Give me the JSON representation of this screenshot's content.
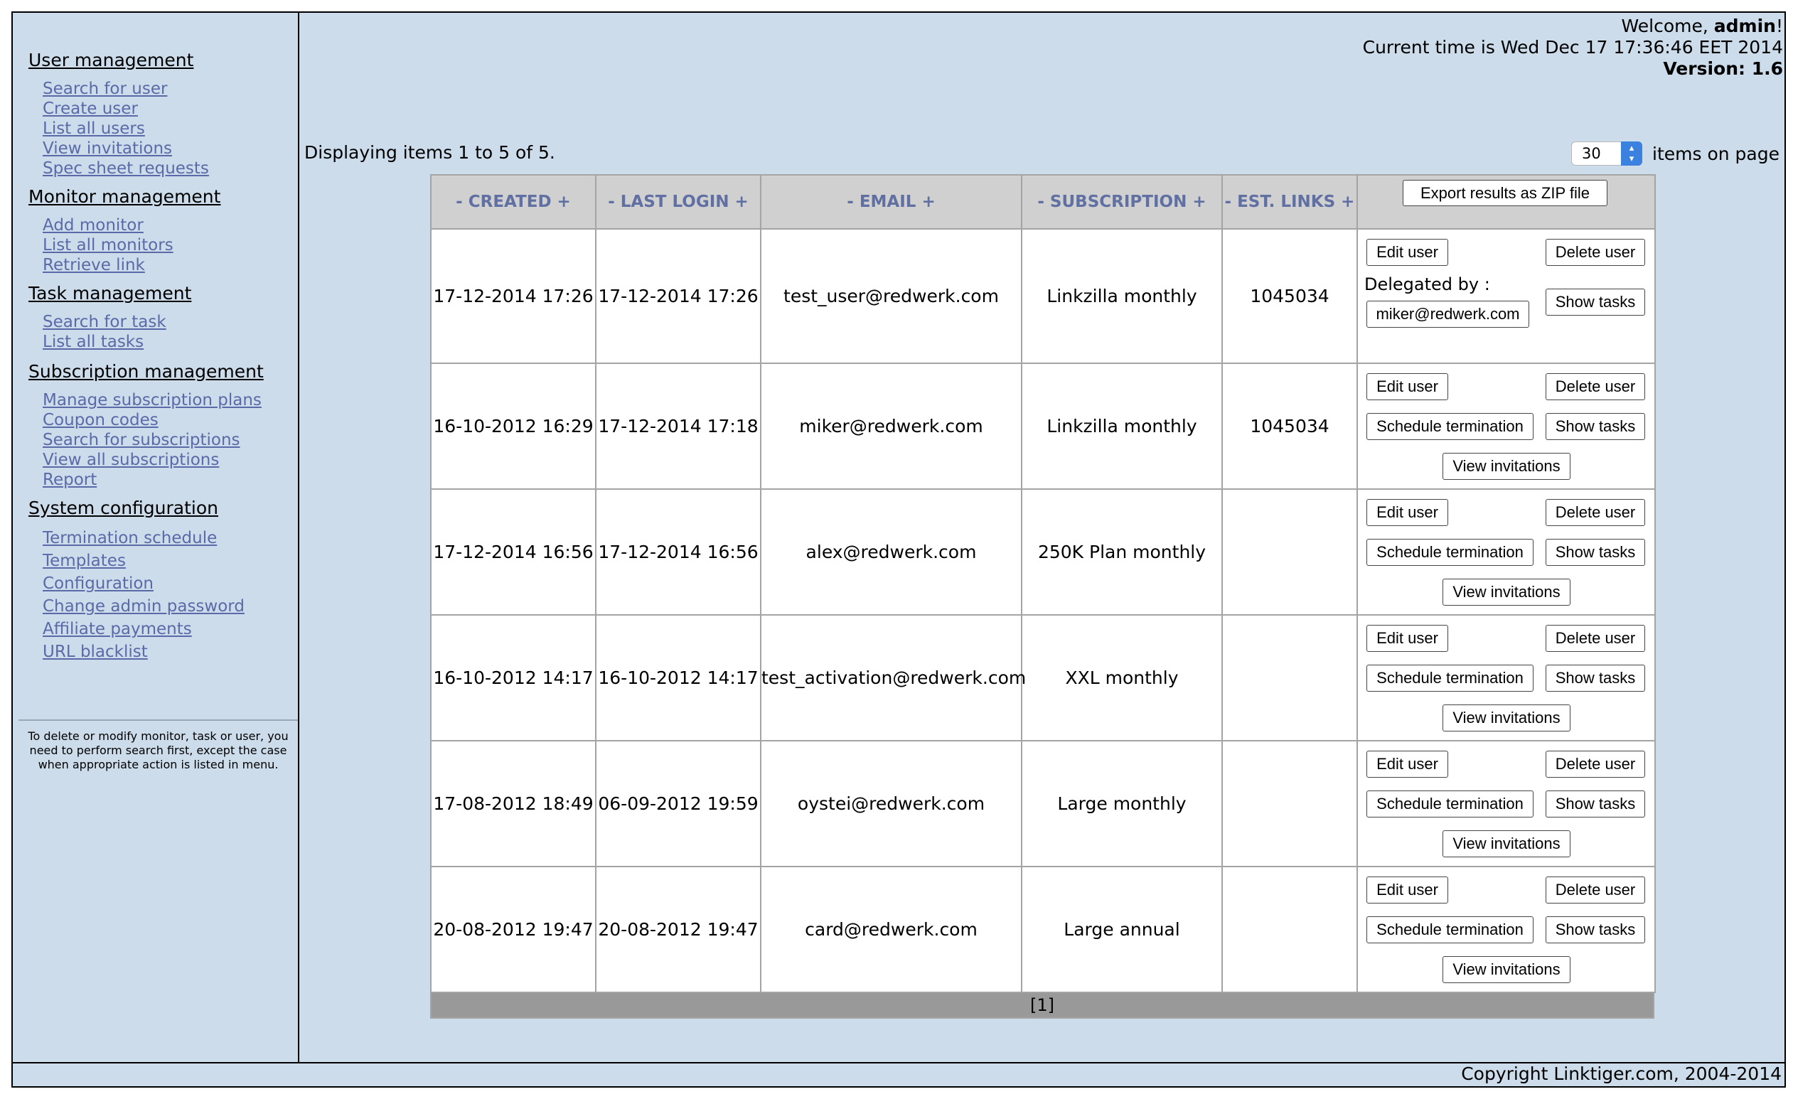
{
  "header": {
    "welcome_prefix": "Welcome, ",
    "welcome_user": "admin",
    "welcome_suffix": "!",
    "current_time": "Current time is Wed Dec 17 17:36:46 EET 2014",
    "version": "Version: 1.6"
  },
  "sidebar": {
    "sections": [
      {
        "title": "User management",
        "items": [
          "Search for user",
          "Create user",
          "List all users",
          "View invitations",
          "Spec sheet requests"
        ]
      },
      {
        "title": "Monitor management",
        "items": [
          "Add monitor",
          "List all monitors",
          "Retrieve link"
        ]
      },
      {
        "title": "Task management",
        "items": [
          "Search for task",
          "List all tasks"
        ]
      },
      {
        "title": "Subscription management",
        "items": [
          "Manage subscription plans",
          "Coupon codes",
          "Search for subscriptions",
          "View all subscriptions",
          "Report"
        ]
      },
      {
        "title": "System configuration",
        "items": [
          "Termination schedule",
          "Templates",
          "Configuration",
          "Change admin password",
          "Affiliate payments",
          "URL blacklist"
        ]
      }
    ],
    "note": "To delete or modify monitor, task or user, you need to perform search first, except the case when appropriate action is listed in menu."
  },
  "listing": {
    "display_text": "Displaying items 1 to 5 of 5.",
    "page_size": "30",
    "page_size_label": "items on page",
    "pager": "[1]"
  },
  "table": {
    "columns": [
      "- CREATED +",
      "- LAST LOGIN +",
      "- EMAIL +",
      "- SUBSCRIPTION +",
      "- EST. LINKS +"
    ],
    "export_label": "Export results as ZIP file",
    "rows": [
      {
        "created": "17-12-2014 17:26",
        "last_login": "17-12-2014 17:26",
        "email": "test_user@redwerk.com",
        "subscription": "Linkzilla monthly",
        "est_links": "1045034"
      },
      {
        "created": "16-10-2012 16:29",
        "last_login": "17-12-2014 17:18",
        "email": "miker@redwerk.com",
        "subscription": "Linkzilla monthly",
        "est_links": "1045034"
      },
      {
        "created": "17-12-2014 16:56",
        "last_login": "17-12-2014 16:56",
        "email": "alex@redwerk.com",
        "subscription": "250K Plan monthly",
        "est_links": ""
      },
      {
        "created": "16-10-2012 14:17",
        "last_login": "16-10-2012 14:17",
        "email": "test_activation@redwerk.com",
        "subscription": "XXL monthly",
        "est_links": ""
      },
      {
        "created": "17-08-2012 18:49",
        "last_login": "06-09-2012 19:59",
        "email": "oystei@redwerk.com",
        "subscription": "Large monthly",
        "est_links": ""
      },
      {
        "created": "20-08-2012 19:47",
        "last_login": "20-08-2012 19:47",
        "email": "card@redwerk.com",
        "subscription": "Large annual",
        "est_links": ""
      }
    ],
    "actions": {
      "edit": "Edit user",
      "delete": "Delete user",
      "schedule": "Schedule termination",
      "show_tasks": "Show tasks",
      "view_invitations": "View invitations",
      "delegated_by": "Delegated by :",
      "delegated_email": "miker@redwerk.com"
    }
  },
  "footer": {
    "copyright": "Copyright Linktiger.com, 2004-2014"
  }
}
